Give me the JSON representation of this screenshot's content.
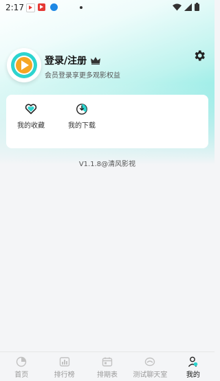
{
  "status_bar": {
    "time": "2:17"
  },
  "profile": {
    "title": "登录/注册",
    "subtitle": "会员登录享更多观影权益"
  },
  "quick_actions": [
    {
      "label": "我的收藏",
      "icon": "heart-icon"
    },
    {
      "label": "我的下载",
      "icon": "download-icon"
    }
  ],
  "version_text": "V1.1.8@清风影视",
  "tabs": [
    {
      "label": "首页",
      "icon": "home-icon"
    },
    {
      "label": "排行榜",
      "icon": "ranking-icon"
    },
    {
      "label": "排期表",
      "icon": "schedule-icon"
    },
    {
      "label": "测试聊天室",
      "icon": "chat-icon"
    },
    {
      "label": "我的",
      "icon": "profile-icon"
    }
  ],
  "colors": {
    "accent": "#2dd4cf",
    "play_orange": "#f5a623"
  }
}
